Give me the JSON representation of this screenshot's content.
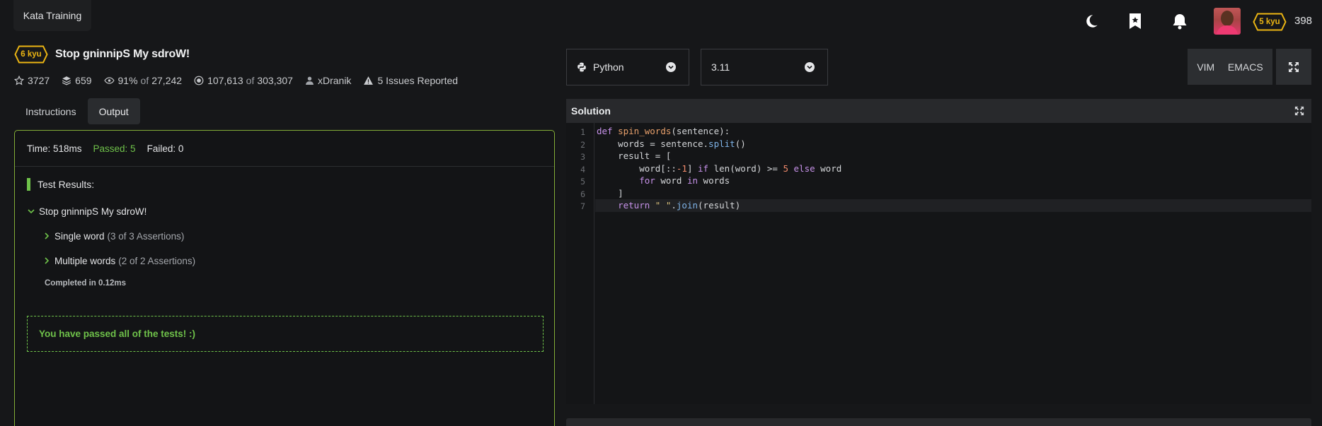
{
  "header": {
    "brand": "Kata Training",
    "user_rank": "5 kyu",
    "honor": "398"
  },
  "kata": {
    "rank": "6 kyu",
    "title": "Stop gninnipS My sdroW!",
    "stats": {
      "stars": "3727",
      "collections": "659",
      "satisfaction": "91%",
      "satisfaction_of": "of",
      "satisfaction_votes": "27,242",
      "completed": "107,613",
      "completed_of": "of",
      "attempted": "303,307",
      "author": "xDranik",
      "issues": "5 Issues Reported"
    }
  },
  "tabs": [
    {
      "label": "Instructions",
      "active": false
    },
    {
      "label": "Output",
      "active": true
    }
  ],
  "output": {
    "time": "Time: 518ms",
    "passed": "Passed: 5",
    "failed": "Failed: 0",
    "results_title": "Test Results:",
    "suite": "Stop gninnipS My sdroW!",
    "groups": [
      {
        "name": "Single word",
        "detail": "(3 of 3 Assertions)"
      },
      {
        "name": "Multiple words",
        "detail": "(2 of 2 Assertions)"
      }
    ],
    "completed": "Completed in 0.12ms",
    "success_message": "You have passed all of the tests! :)"
  },
  "editor": {
    "language": "Python",
    "version": "3.11",
    "modes": [
      "VIM",
      "EMACS"
    ],
    "panel_title": "Solution",
    "line_numbers": [
      "1",
      "2",
      "3",
      "4",
      "5",
      "6",
      "7"
    ],
    "code": {
      "l1_def": "def",
      "l1_fn": "spin_words",
      "l1_rest": "(sentence):",
      "l2_a": "    words = sentence.",
      "l2_split": "split",
      "l2_b": "()",
      "l3": "    result = [",
      "l4_a": "        word[::",
      "l4_num1": "-1",
      "l4_b": "] ",
      "l4_if": "if",
      "l4_c": " ",
      "l4_len": "len",
      "l4_d": "(word) >= ",
      "l4_num5": "5",
      "l4_e": " ",
      "l4_else": "else",
      "l4_f": " word",
      "l5_a": "        ",
      "l5_for": "for",
      "l5_b": " word ",
      "l5_in": "in",
      "l5_c": " words",
      "l6": "    ]",
      "l7_a": "    ",
      "l7_return": "return",
      "l7_b": " ",
      "l7_str": "\" \"",
      "l7_c": ".",
      "l7_join": "join",
      "l7_d": "(result)"
    }
  },
  "colors": {
    "accent_green": "#6fc24a",
    "output_border": "#83ad37",
    "kyu_yellow": "#ecb613"
  }
}
